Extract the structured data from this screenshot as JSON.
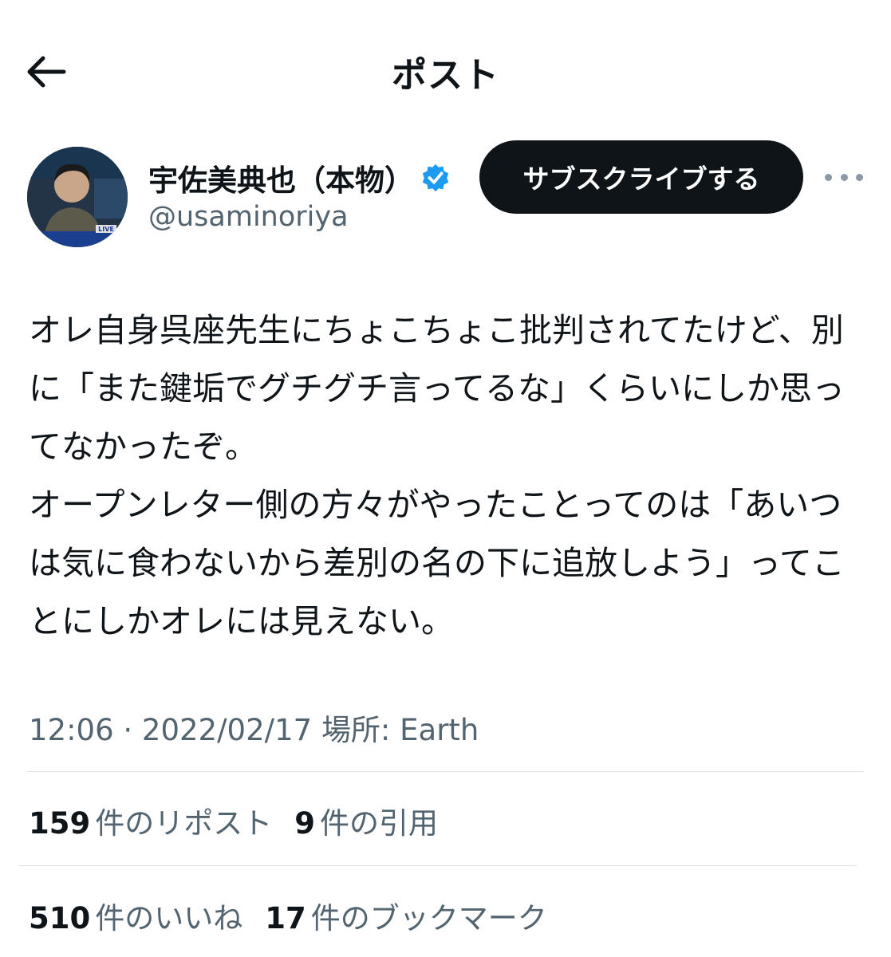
{
  "header": {
    "title": "ポスト",
    "back_icon": "arrow-left-icon"
  },
  "author": {
    "display_name": "宇佐美典也（本物）",
    "handle": "@usaminoriya",
    "verified": true,
    "verified_color": "#1d9bf0",
    "avatar_caption": "LIVE"
  },
  "actions": {
    "subscribe_label": "サブスクライブする",
    "more_icon": "more-horizontal-icon"
  },
  "tweet": {
    "text": "オレ自身呉座先生にちょこちょこ批判されてたけど、別に「また鍵垢でグチグチ言ってるな」くらいにしか思ってなかったぞ。\nオープンレター側の方々がやったことってのは「あいつは気に食わないから差別の名の下に追放しよう」ってことにしかオレには見えない。"
  },
  "meta": {
    "time": "12:06 · 2022/02/17",
    "location": "場所: Earth"
  },
  "stats": {
    "reposts_count": "159",
    "reposts_label": "件のリポスト",
    "quotes_count": "9",
    "quotes_label": "件の引用",
    "likes_count": "510",
    "likes_label": "件のいいね",
    "bookmarks_count": "17",
    "bookmarks_label": "件のブックマーク"
  }
}
